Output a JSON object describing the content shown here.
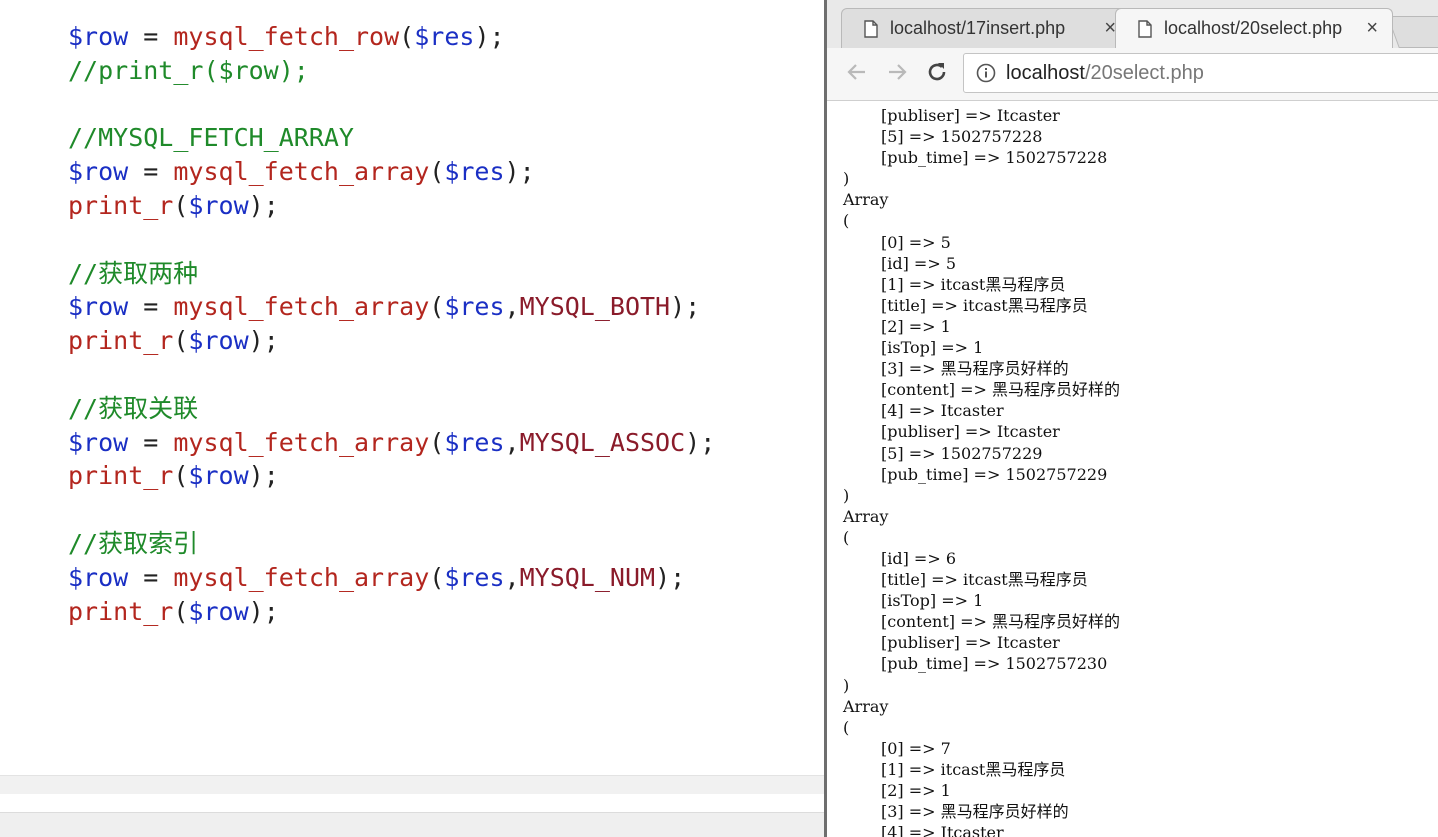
{
  "editor": {
    "lines": [
      [
        {
          "t": "$row",
          "c": "var"
        },
        {
          "t": " = ",
          "c": "p"
        },
        {
          "t": "mysql_fetch_row",
          "c": "fn"
        },
        {
          "t": "(",
          "c": "p"
        },
        {
          "t": "$res",
          "c": "var"
        },
        {
          "t": ");",
          "c": "p"
        }
      ],
      [
        {
          "t": "//print_r($row);",
          "c": "cmt"
        }
      ],
      [],
      [
        {
          "t": "//MYSQL_FETCH_ARRAY",
          "c": "cmt"
        }
      ],
      [
        {
          "t": "$row",
          "c": "var"
        },
        {
          "t": " = ",
          "c": "p"
        },
        {
          "t": "mysql_fetch_array",
          "c": "fn"
        },
        {
          "t": "(",
          "c": "p"
        },
        {
          "t": "$res",
          "c": "var"
        },
        {
          "t": ");",
          "c": "p"
        }
      ],
      [
        {
          "t": "print_r",
          "c": "fn"
        },
        {
          "t": "(",
          "c": "p"
        },
        {
          "t": "$row",
          "c": "var"
        },
        {
          "t": ");",
          "c": "p"
        }
      ],
      [],
      [
        {
          "t": "//获取两种",
          "c": "cmt"
        }
      ],
      [
        {
          "t": "$row",
          "c": "var"
        },
        {
          "t": " = ",
          "c": "p"
        },
        {
          "t": "mysql_fetch_array",
          "c": "fn"
        },
        {
          "t": "(",
          "c": "p"
        },
        {
          "t": "$res",
          "c": "var"
        },
        {
          "t": ",",
          "c": "p"
        },
        {
          "t": "MYSQL_BOTH",
          "c": "const"
        },
        {
          "t": ");",
          "c": "p"
        }
      ],
      [
        {
          "t": "print_r",
          "c": "fn"
        },
        {
          "t": "(",
          "c": "p"
        },
        {
          "t": "$row",
          "c": "var"
        },
        {
          "t": ");",
          "c": "p"
        }
      ],
      [],
      [
        {
          "t": "//获取关联",
          "c": "cmt"
        }
      ],
      [
        {
          "t": "$row",
          "c": "var"
        },
        {
          "t": " = ",
          "c": "p"
        },
        {
          "t": "mysql_fetch_array",
          "c": "fn"
        },
        {
          "t": "(",
          "c": "p"
        },
        {
          "t": "$res",
          "c": "var"
        },
        {
          "t": ",",
          "c": "p"
        },
        {
          "t": "MYSQL_ASSOC",
          "c": "const"
        },
        {
          "t": ");",
          "c": "p"
        }
      ],
      [
        {
          "t": "print_r",
          "c": "fn"
        },
        {
          "t": "(",
          "c": "p"
        },
        {
          "t": "$row",
          "c": "var"
        },
        {
          "t": ");",
          "c": "p"
        }
      ],
      [],
      [
        {
          "t": "//获取索引",
          "c": "cmt"
        }
      ],
      [
        {
          "t": "$row",
          "c": "var"
        },
        {
          "t": " = ",
          "c": "p"
        },
        {
          "t": "mysql_fetch_array",
          "c": "fn"
        },
        {
          "t": "(",
          "c": "p"
        },
        {
          "t": "$res",
          "c": "var"
        },
        {
          "t": ",",
          "c": "p"
        },
        {
          "t": "MYSQL_NUM",
          "c": "const"
        },
        {
          "t": ");",
          "c": "p"
        }
      ],
      [
        {
          "t": "print_r",
          "c": "fn"
        },
        {
          "t": "(",
          "c": "p"
        },
        {
          "t": "$row",
          "c": "var"
        },
        {
          "t": ");",
          "c": "p"
        }
      ]
    ]
  },
  "browser": {
    "tabs": [
      {
        "title": "localhost/17insert.php",
        "icon": "document-icon",
        "close": "×",
        "active": false
      },
      {
        "title": "localhost/20select.php",
        "icon": "document-icon",
        "close": "×",
        "active": true
      }
    ],
    "toolbar": {
      "back_icon": "arrow-left-icon",
      "forward_icon": "arrow-right-icon",
      "reload_icon": "reload-icon",
      "info_icon": "info-icon",
      "url_host": "localhost",
      "url_path": "/20select.php"
    },
    "output_lines": [
      {
        "t": "[publiser] => Itcaster",
        "i": true
      },
      {
        "t": "[5] => 1502757228",
        "i": true
      },
      {
        "t": "[pub_time] => 1502757228",
        "i": true
      },
      {
        "t": ")",
        "i": false
      },
      {
        "t": "Array",
        "i": false
      },
      {
        "t": "(",
        "i": false
      },
      {
        "t": "[0] => 5",
        "i": true
      },
      {
        "t": "[id] => 5",
        "i": true
      },
      {
        "t": "[1] => itcast黑马程序员",
        "i": true
      },
      {
        "t": "[title] => itcast黑马程序员",
        "i": true
      },
      {
        "t": "[2] => 1",
        "i": true
      },
      {
        "t": "[isTop] => 1",
        "i": true
      },
      {
        "t": "[3] => 黑马程序员好样的",
        "i": true
      },
      {
        "t": "[content] => 黑马程序员好样的",
        "i": true
      },
      {
        "t": "[4] => Itcaster",
        "i": true
      },
      {
        "t": "[publiser] => Itcaster",
        "i": true
      },
      {
        "t": "[5] => 1502757229",
        "i": true
      },
      {
        "t": "[pub_time] => 1502757229",
        "i": true
      },
      {
        "t": ")",
        "i": false
      },
      {
        "t": "Array",
        "i": false
      },
      {
        "t": "(",
        "i": false
      },
      {
        "t": "[id] => 6",
        "i": true
      },
      {
        "t": "[title] => itcast黑马程序员",
        "i": true
      },
      {
        "t": "[isTop] => 1",
        "i": true
      },
      {
        "t": "[content] => 黑马程序员好样的",
        "i": true
      },
      {
        "t": "[publiser] => Itcaster",
        "i": true
      },
      {
        "t": "[pub_time] => 1502757230",
        "i": true
      },
      {
        "t": ")",
        "i": false
      },
      {
        "t": "Array",
        "i": false
      },
      {
        "t": "(",
        "i": false
      },
      {
        "t": "[0] => 7",
        "i": true
      },
      {
        "t": "[1] => itcast黑马程序员",
        "i": true
      },
      {
        "t": "[2] => 1",
        "i": true
      },
      {
        "t": "[3] => 黑马程序员好样的",
        "i": true
      },
      {
        "t": "[4] => Itcaster",
        "i": true
      }
    ]
  }
}
